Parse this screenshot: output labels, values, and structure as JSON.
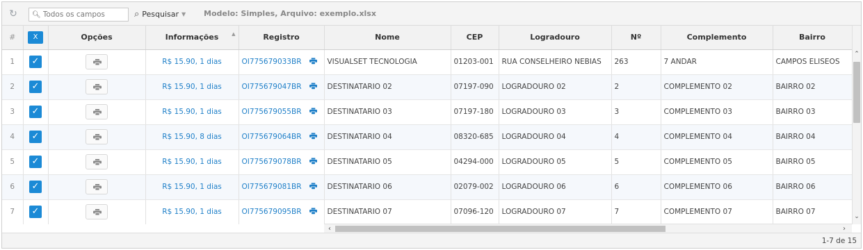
{
  "toolbar": {
    "search_placeholder": "Todos os campos",
    "search_button": "Pesquisar",
    "model_info": "Modelo: Simples, Arquivo: exemplo.xlsx"
  },
  "grid": {
    "headers": {
      "row_number": "#",
      "select_all": "X",
      "opcoes": "Opções",
      "informacoes": "Informações",
      "registro": "Registro",
      "nome": "Nome",
      "cep": "CEP",
      "logradouro": "Logradouro",
      "numero": "Nº",
      "complemento": "Complemento",
      "bairro": "Bairro"
    },
    "rows": [
      {
        "n": "1",
        "info": "R$ 15.90, 1 dias",
        "registro": "OI775679033BR",
        "nome": "VISUALSET TECNOLOGIA",
        "cep": "01203-001",
        "logradouro": "RUA CONSELHEIRO NEBIAS",
        "numero": "263",
        "complemento": "7 ANDAR",
        "bairro": "CAMPOS ELISEOS"
      },
      {
        "n": "2",
        "info": "R$ 15.90, 1 dias",
        "registro": "OI775679047BR",
        "nome": "DESTINATARIO 02",
        "cep": "07197-090",
        "logradouro": "LOGRADOURO 02",
        "numero": "2",
        "complemento": "COMPLEMENTO 02",
        "bairro": "BAIRRO 02"
      },
      {
        "n": "3",
        "info": "R$ 15.90, 1 dias",
        "registro": "OI775679055BR",
        "nome": "DESTINATARIO 03",
        "cep": "07197-180",
        "logradouro": "LOGRADOURO 03",
        "numero": "3",
        "complemento": "COMPLEMENTO 03",
        "bairro": "BAIRRO 03"
      },
      {
        "n": "4",
        "info": "R$ 15.90, 8 dias",
        "registro": "OI775679064BR",
        "nome": "DESTINATARIO 04",
        "cep": "08320-685",
        "logradouro": "LOGRADOURO 04",
        "numero": "4",
        "complemento": "COMPLEMENTO 04",
        "bairro": "BAIRRO 04"
      },
      {
        "n": "5",
        "info": "R$ 15.90, 1 dias",
        "registro": "OI775679078BR",
        "nome": "DESTINATARIO 05",
        "cep": "04294-000",
        "logradouro": "LOGRADOURO 05",
        "numero": "5",
        "complemento": "COMPLEMENTO 05",
        "bairro": "BAIRRO 05"
      },
      {
        "n": "6",
        "info": "R$ 15.90, 1 dias",
        "registro": "OI775679081BR",
        "nome": "DESTINATARIO 06",
        "cep": "02079-002",
        "logradouro": "LOGRADOURO 06",
        "numero": "6",
        "complemento": "COMPLEMENTO 06",
        "bairro": "BAIRRO 06"
      },
      {
        "n": "7",
        "info": "R$ 15.90, 1 dias",
        "registro": "OI775679095BR",
        "nome": "DESTINATARIO 07",
        "cep": "07096-120",
        "logradouro": "LOGRADOURO 07",
        "numero": "7",
        "complemento": "COMPLEMENTO 07",
        "bairro": "BAIRRO 07"
      }
    ]
  },
  "pager": {
    "text": "1-7 de 15"
  },
  "icons": {
    "refresh": "refresh-icon",
    "search": "search-icon",
    "checkbox": "checkmark-icon",
    "print": "printer-icon"
  },
  "colors": {
    "accent": "#1b8ad6",
    "link": "#1e7fc8"
  }
}
